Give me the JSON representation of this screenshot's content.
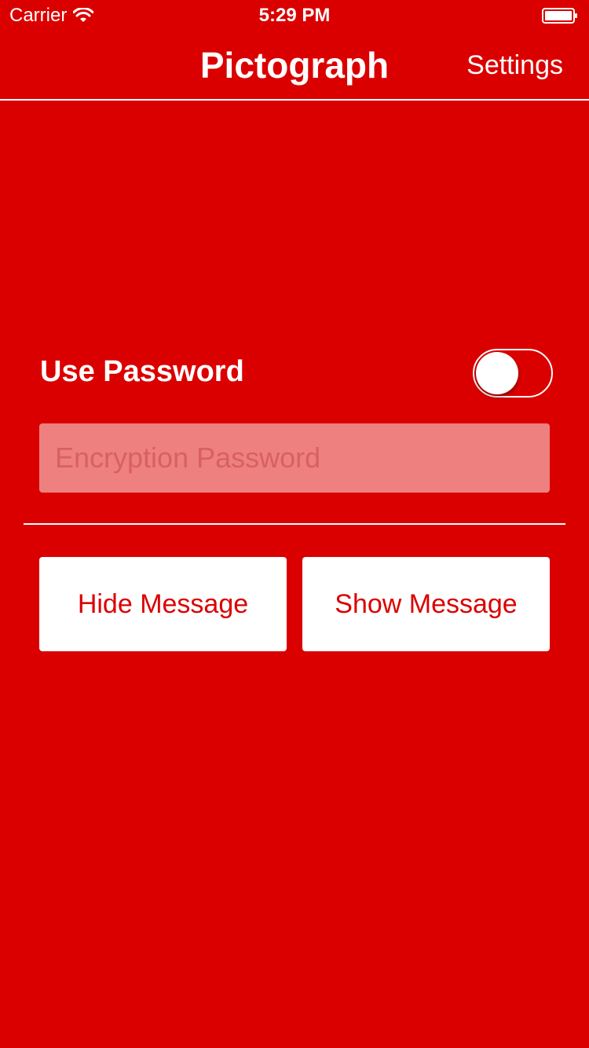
{
  "status_bar": {
    "carrier": "Carrier",
    "time": "5:29 PM"
  },
  "nav": {
    "title": "Pictograph",
    "settings_label": "Settings"
  },
  "password_section": {
    "toggle_label": "Use Password",
    "toggle_on": false,
    "field_placeholder": "Encryption Password",
    "field_value": ""
  },
  "actions": {
    "hide_label": "Hide Message",
    "show_label": "Show Message"
  },
  "colors": {
    "background": "#db0000",
    "button_bg": "#ffffff",
    "button_text": "#db0000",
    "field_bg": "#ee8080"
  },
  "icons": {
    "wifi": "wifi-icon",
    "battery": "battery-icon"
  }
}
